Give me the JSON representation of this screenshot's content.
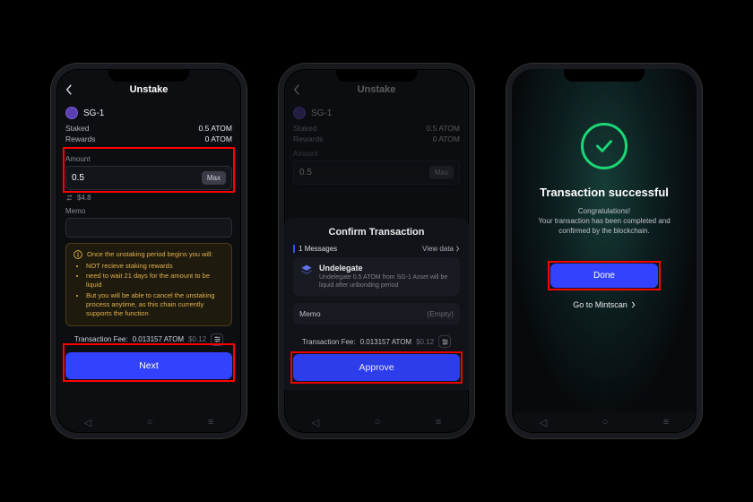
{
  "phone1": {
    "title": "Unstake",
    "validator": {
      "name": "SG-1"
    },
    "stats": {
      "staked_label": "Staked",
      "staked_value": "0.5 ATOM",
      "rewards_label": "Rewards",
      "rewards_value": "0 ATOM"
    },
    "amount_label": "Amount",
    "amount_value": "0.5",
    "max_label": "Max",
    "fiat_value": "$4.8",
    "memo_label": "Memo",
    "warning": {
      "head": "Once the unstaking period begins you will:",
      "items": [
        "NOT recieve staking rewards",
        "need to wait 21 days for the amount to be liquid",
        "But you will be able to cancel the unstaking process anytime, as this chain currently supports the function"
      ]
    },
    "fee_label": "Transaction Fee:",
    "fee_value": "0.013157 ATOM",
    "fee_fiat": "$0.12",
    "next_label": "Next"
  },
  "phone2": {
    "title": "Unstake",
    "validator": {
      "name": "SG-1"
    },
    "stats": {
      "staked_label": "Staked",
      "staked_value": "0.5 ATOM",
      "rewards_label": "Rewards",
      "rewards_value": "0 ATOM"
    },
    "amount_label": "Amount",
    "amount_value": "0.5",
    "max_label": "Max",
    "modal_title": "Confirm Transaction",
    "messages_label": "Messages",
    "messages_badge": "1",
    "view_data": "View data",
    "msg": {
      "title": "Undelegate",
      "desc": "Undelegate 0.5 ATOM from SG-1 Asset will be liquid after unbonding period"
    },
    "memo_label": "Memo",
    "memo_value": "(Empty)",
    "fee_label": "Transaction Fee:",
    "fee_value": "0.013157 ATOM",
    "fee_fiat": "$0.12",
    "approve_label": "Approve"
  },
  "phone3": {
    "title": "Transaction successful",
    "congrats": "Congratulations!",
    "desc": "Your transaction has been completed and confirmed by the blockchain.",
    "done_label": "Done",
    "mintscan_label": "Go to Mintscan"
  }
}
